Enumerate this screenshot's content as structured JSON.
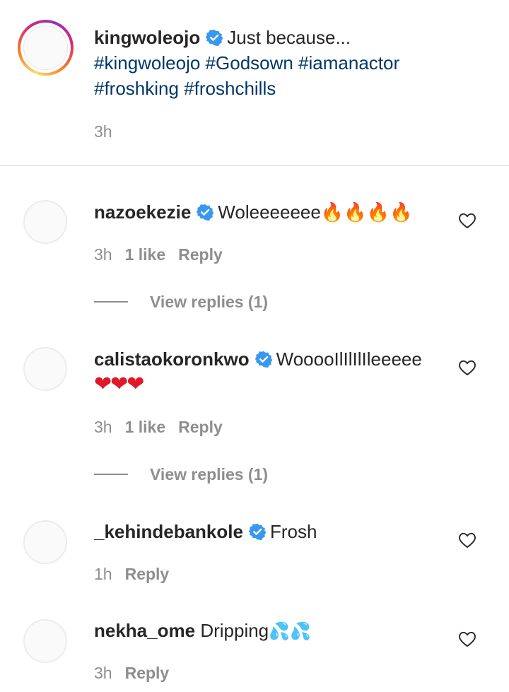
{
  "caption": {
    "username": "kingwoleojo",
    "text": "Just because...",
    "hashtags_line1": "#kingwoleojo #Godsown #iamanactor",
    "hashtags_line2": "#froshking #froshchills",
    "time": "3h"
  },
  "comments": [
    {
      "username": "nazoekezie",
      "text": "Woleeeeeee",
      "emoji": "🔥🔥🔥🔥",
      "time": "3h",
      "likes": "1 like",
      "reply": "Reply",
      "view_replies": "View replies (1)"
    },
    {
      "username": "calistaokoronkwo",
      "text": "WooooIlIlIlIleeeee",
      "emoji": "❤❤❤",
      "time": "3h",
      "likes": "1 like",
      "reply": "Reply",
      "view_replies": "View replies (1)"
    },
    {
      "username": "_kehindebankole",
      "text": "Frosh",
      "time": "1h",
      "reply": "Reply"
    },
    {
      "username": "nekha_ome",
      "text": "Dripping",
      "emoji": "💦💦",
      "time": "3h",
      "reply": "Reply"
    }
  ],
  "icons": {
    "verified": "verified-badge-icon",
    "like": "heart-outline-icon"
  },
  "colors": {
    "username": "#262626",
    "hashtag": "#00376b",
    "meta": "#8e8e8e",
    "verified": "#3897f0",
    "divider": "#dbdbdb"
  }
}
